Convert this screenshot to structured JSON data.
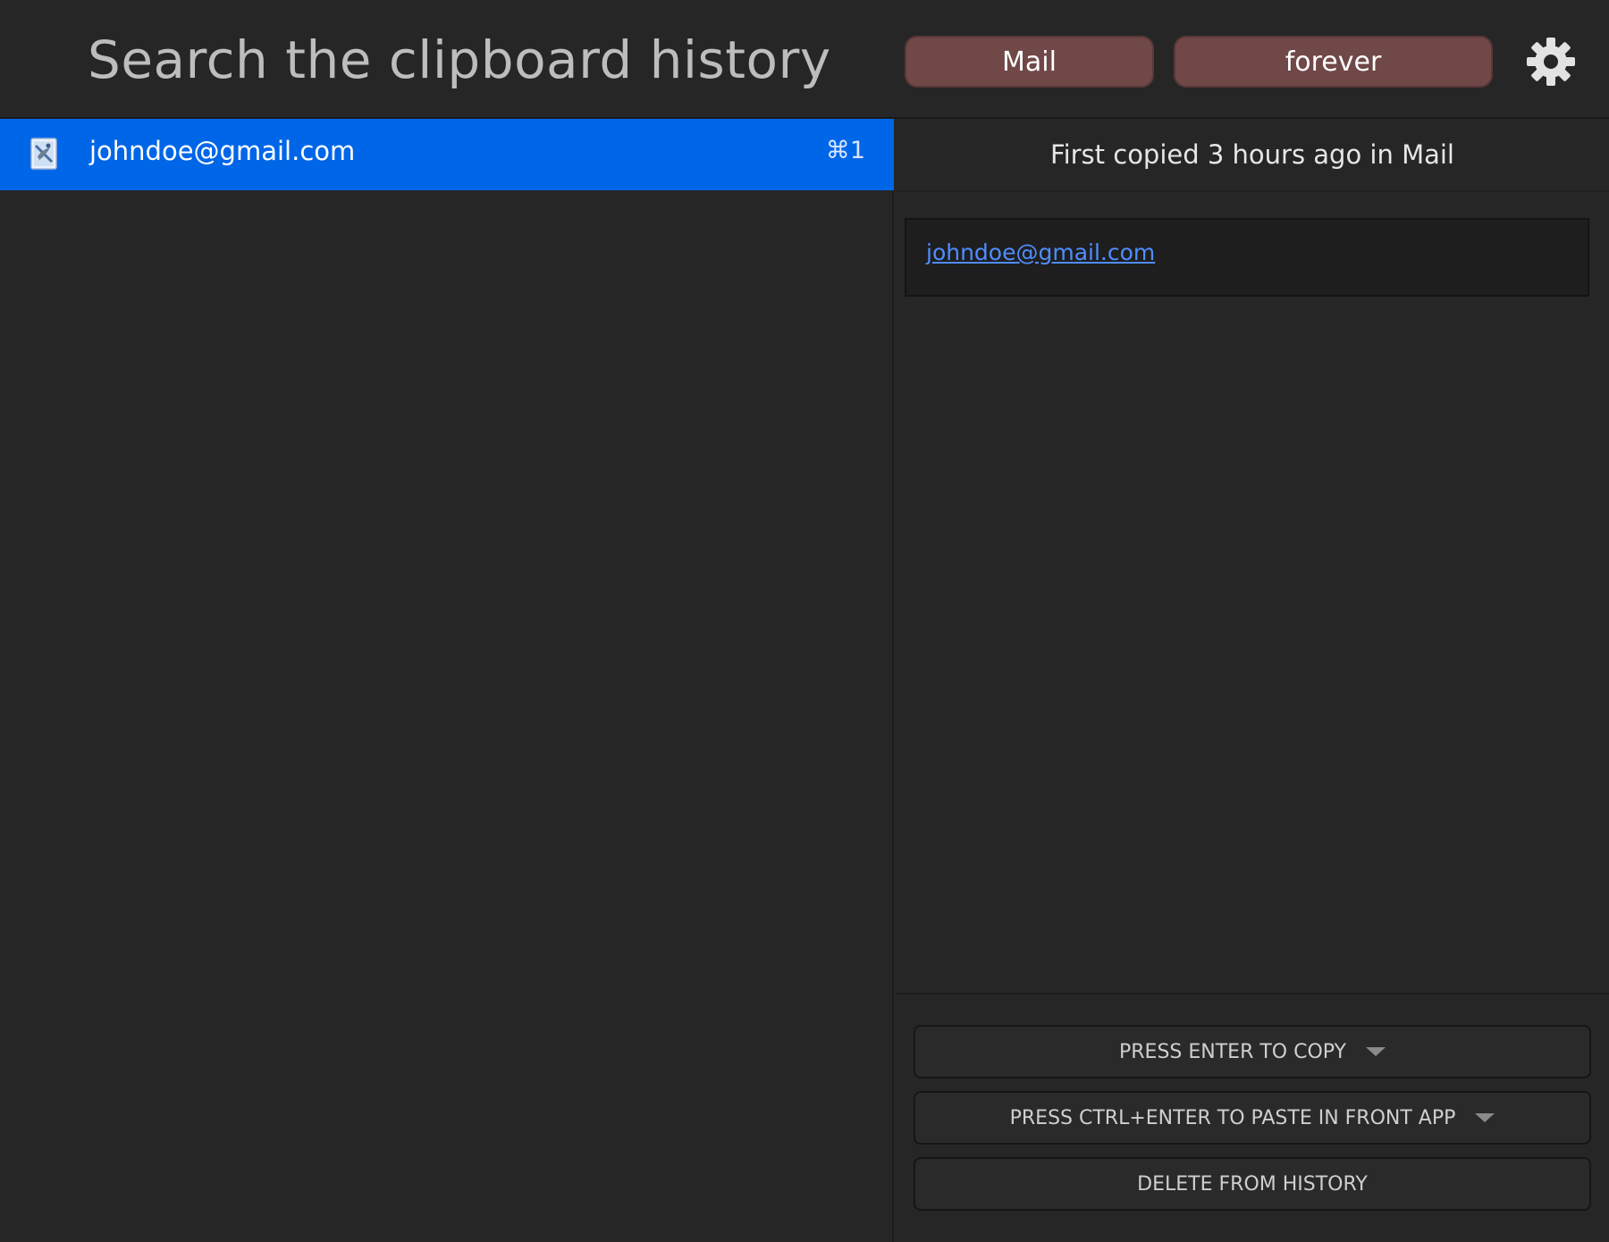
{
  "search": {
    "placeholder": "Search the clipboard history"
  },
  "filters": {
    "app": "Mail",
    "time": "forever"
  },
  "settings": {
    "icon": "gear-icon"
  },
  "list": {
    "items": [
      {
        "app_icon": "mail-app-icon",
        "text": "johndoe@gmail.com",
        "shortcut": "⌘1",
        "selected": true
      }
    ]
  },
  "detail": {
    "meta": "First copied 3 hours ago in Mail",
    "preview_text": "johndoe@gmail.com"
  },
  "actions": {
    "copy_label": "PRESS ENTER TO COPY",
    "paste_label": "PRESS CTRL+ENTER TO PASTE IN FRONT APP",
    "delete_label": "DELETE FROM HISTORY"
  },
  "colors": {
    "background": "#262626",
    "selection": "#0066e8",
    "filter_pill": "#704848",
    "link": "#4f8dff"
  }
}
